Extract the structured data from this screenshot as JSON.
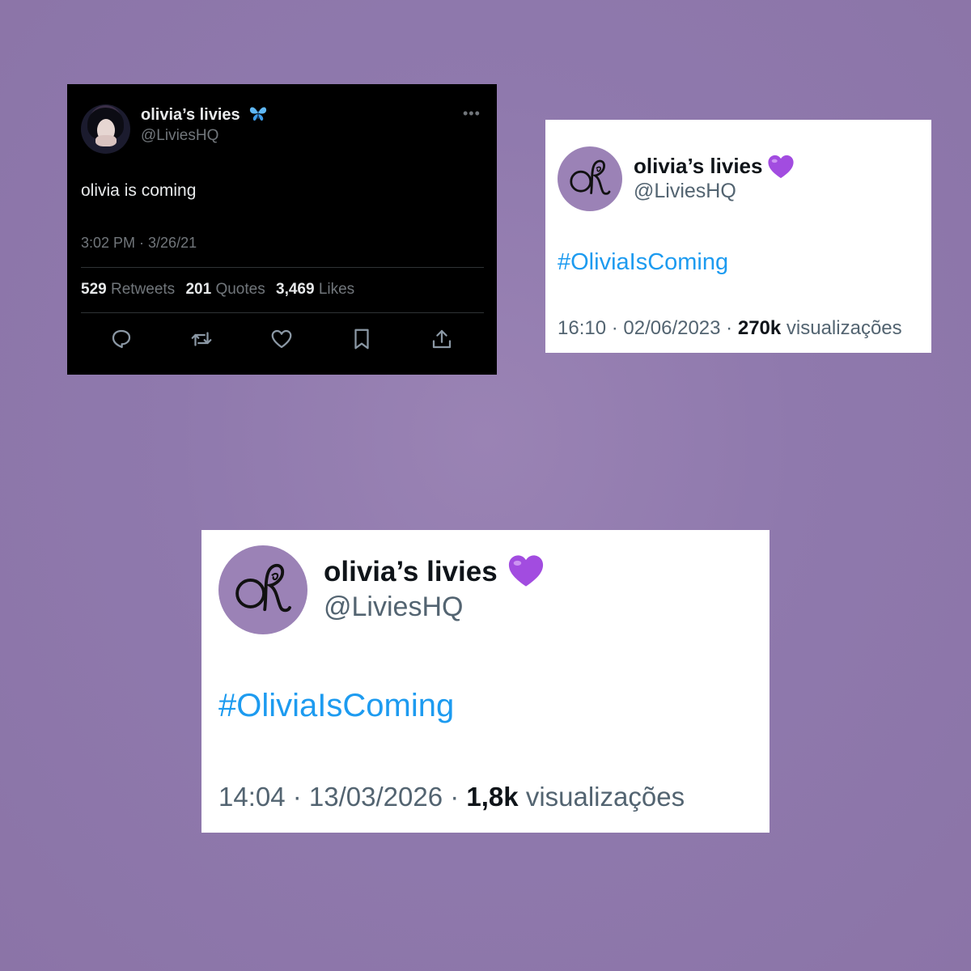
{
  "tweet_dark": {
    "name": "olivia’s livies",
    "name_icon": "blue-butterfly-icon",
    "handle": "@LiviesHQ",
    "text": "olivia is coming",
    "time": "3:02 PM · 3/26/21",
    "stats": [
      {
        "count": "529",
        "label": "Retweets"
      },
      {
        "count": "201",
        "label": "Quotes"
      },
      {
        "count": "3,469",
        "label": "Likes"
      }
    ],
    "actions": [
      "reply-icon",
      "retweet-icon",
      "like-icon",
      "bookmark-icon",
      "share-icon"
    ]
  },
  "tweet_2": {
    "name": "olivia’s livies",
    "name_icon": "purple-heart-icon",
    "handle": "@LiviesHQ",
    "hashtag": "#OliviaIsComing",
    "time": "16:10 · 02/06/2023 · ",
    "views": "270k",
    "views_label": "visualizações"
  },
  "tweet_3": {
    "name": "olivia’s livies",
    "name_icon": "purple-heart-icon",
    "handle": "@LiviesHQ",
    "hashtag": "#OliviaIsComing",
    "time": "14:04 · 13/03/2026 · ",
    "views": "1,8k",
    "views_label": "visualizações"
  },
  "colors": {
    "background": "#8f79ad",
    "link_blue": "#1d9bf0",
    "avatar_purple": "#9b82b6",
    "heart_purple": "#a24ce0"
  }
}
